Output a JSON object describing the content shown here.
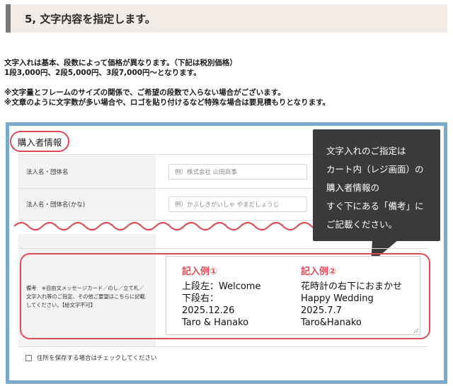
{
  "section": {
    "title": "5, 文字内容を指定します。"
  },
  "intro": {
    "line1": "文字入れは基本、段数によって価格が異なります。（下記は税別価格）",
    "line2": "1段3,000円、2段5,000円、3段7,000円～となります。",
    "note1": "※文字量とフレームのサイズの関係で、ご希望の段数で入らない場合がございます。",
    "note2": "※文章のように文字数が多い場合や、ロゴを貼り付けるなど特殊な場合は要見積もりとなります。"
  },
  "form": {
    "buyer_title": "購入者情報",
    "company_label": "法人名・団体名",
    "company_placeholder": "例）株式会社 山田商事",
    "company_kana_label": "法人名・団体名(かな)",
    "company_kana_placeholder": "例）かぶしきがいしゃ やまだしょうじ",
    "remarks_label_line1": "備考　※自由文メッセージカード／のし／立て札／",
    "remarks_label_line2": "文字入れ等のご指定、その他ご要望はこちらに記載",
    "remarks_label_line3": "してください。【絵文字不可】",
    "save_address_label": "住所を保存する場合はチェックしてください"
  },
  "callout": {
    "line1": "文字入れのご指定は",
    "line2": "カート内（レジ画面）の",
    "line3": "購入者情報の",
    "line4": "すぐ下にある「備考」に",
    "line5": "ご記載ください。"
  },
  "examples": [
    {
      "title": "記入例①",
      "lines": [
        "上段左：Welcome",
        "下段右：",
        "2025.12.26",
        "Taro & Hanako"
      ]
    },
    {
      "title": "記入例②",
      "lines": [
        "花時計の右下におまかせ",
        "Happy Wedding",
        "2025.7.7",
        "Taro&Hanako"
      ]
    }
  ],
  "colors": {
    "frame": "#79aacb",
    "accent_red": "#e34a56",
    "callout_bg": "#3a3a3a",
    "header_bg": "#f2ebe6"
  }
}
